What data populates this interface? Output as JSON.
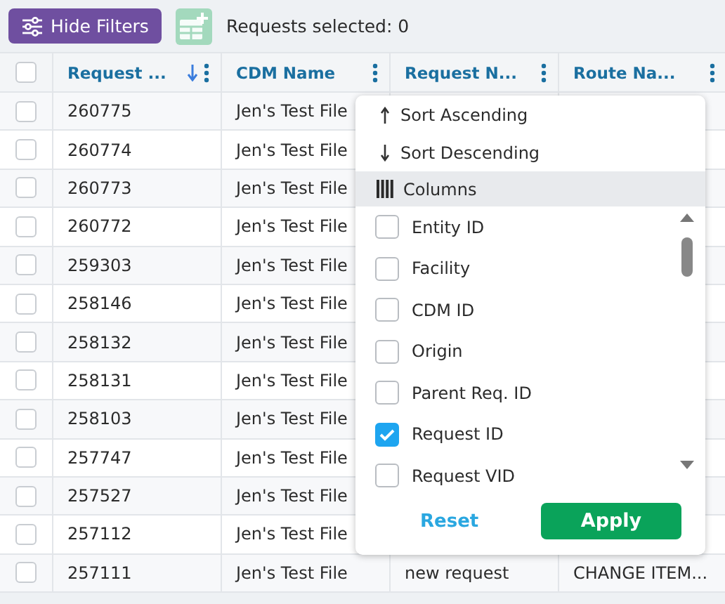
{
  "toolbar": {
    "filter_button": "Hide Filters",
    "selection_text": "Requests selected: 0"
  },
  "table": {
    "select_all": {
      "checked": false
    },
    "columns": [
      {
        "label": "Request ...",
        "sorted": true
      },
      {
        "label": "CDM Name",
        "sorted": false
      },
      {
        "label": "Request N...",
        "sorted": false
      },
      {
        "label": "Route Na...",
        "sorted": false
      }
    ],
    "rows": [
      {
        "checked": false,
        "cells": [
          "260775",
          "Jen's Test File"
        ]
      },
      {
        "checked": false,
        "cells": [
          "260774",
          "Jen's Test File"
        ]
      },
      {
        "checked": false,
        "cells": [
          "260773",
          "Jen's Test File"
        ]
      },
      {
        "checked": false,
        "cells": [
          "260772",
          "Jen's Test File"
        ]
      },
      {
        "checked": false,
        "cells": [
          "259303",
          "Jen's Test File"
        ]
      },
      {
        "checked": false,
        "cells": [
          "258146",
          "Jen's Test File"
        ]
      },
      {
        "checked": false,
        "cells": [
          "258132",
          "Jen's Test File"
        ]
      },
      {
        "checked": false,
        "cells": [
          "258131",
          "Jen's Test File"
        ]
      },
      {
        "checked": false,
        "cells": [
          "258103",
          "Jen's Test File"
        ]
      },
      {
        "checked": false,
        "cells": [
          "257747",
          "Jen's Test File"
        ]
      },
      {
        "checked": false,
        "cells": [
          "257527",
          "Jen's Test File"
        ]
      },
      {
        "checked": false,
        "cells": [
          "257112",
          "Jen's Test File"
        ]
      },
      {
        "checked": false,
        "cells": [
          "257111",
          "Jen's Test File",
          "new request",
          "CHANGE ITEM..."
        ]
      }
    ]
  },
  "column_menu": {
    "sort_items": [
      {
        "kind": "asc",
        "label": "Sort Ascending"
      },
      {
        "kind": "desc",
        "label": "Sort Descending"
      }
    ],
    "columns_header": "Columns",
    "options": [
      {
        "label": "Entity ID",
        "checked": false
      },
      {
        "label": "Facility",
        "checked": false
      },
      {
        "label": "CDM ID",
        "checked": false
      },
      {
        "label": "Origin",
        "checked": false
      },
      {
        "label": "Parent Req. ID",
        "checked": false
      },
      {
        "label": "Request ID",
        "checked": true
      },
      {
        "label": "Request VID",
        "checked": false
      }
    ],
    "reset_button": "Reset",
    "apply_button": "Apply"
  }
}
